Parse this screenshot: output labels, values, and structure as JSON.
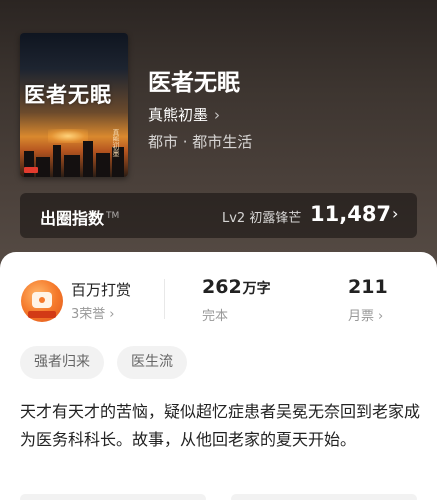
{
  "book": {
    "cover_title": "医者无眠",
    "cover_author": "真熊初墨",
    "title": "医者无眠",
    "author": "真熊初墨",
    "genre": "都市 · 都市生活"
  },
  "index": {
    "label": "出圈指数",
    "tm": "TM",
    "level": "Lv2 初露锋芒",
    "value": "11,487"
  },
  "stats": {
    "reward": {
      "title": "百万打赏",
      "sub": "3荣誉"
    },
    "words": {
      "value": "262",
      "unit": "万字",
      "label": "完本"
    },
    "monthly": {
      "value": "211",
      "label": "月票"
    }
  },
  "tags": [
    "强者归来",
    "医生流"
  ],
  "synopsis": "天才有天才的苦恼，疑似超忆症患者吴冕无奈回到老家成为医务科科长。故事，从他回老家的夏天开始。",
  "icons": {
    "author_chevron": "chevron-right-icon",
    "index_chevron": "chevron-right-icon",
    "reward": "reward-badge-icon"
  }
}
